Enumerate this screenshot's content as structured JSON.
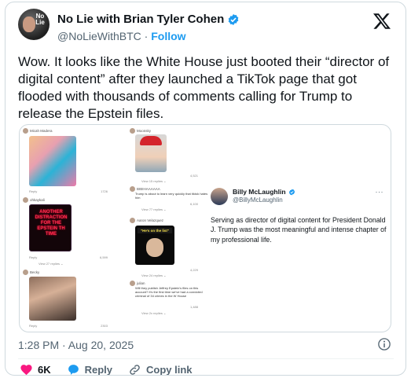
{
  "author": {
    "display_name": "No Lie with Brian Tyler Cohen",
    "handle": "@NoLieWithBTC",
    "separator": " · ",
    "follow_label": "Follow",
    "avatar_text": "No Lie"
  },
  "tweet": {
    "text": "Wow. It looks like the White House just booted their “director of digital content” after they launched a TikTok page that got flooded with thousands of comments calling for Trump to release the Epstein files."
  },
  "media": {
    "tiktok": {
      "col1": [
        {
          "user": "Micah Madera",
          "likes": "1726",
          "reply": "Reply",
          "replies": ""
        },
        {
          "user": "ohkaykali",
          "likes": "6,599",
          "reply": "Reply",
          "replies": "View 27 replies ⌄",
          "neon": "ANOTHER DISTRACTION FOR THE EPSTEIN TH TIME"
        },
        {
          "user": "Becky",
          "likes": "2303",
          "reply": "Reply",
          "replies": ""
        }
      ],
      "col2": [
        {
          "user": "Moonsky",
          "likes": "4,521",
          "replies": "View 15 replies ⌄"
        },
        {
          "user": "BIBIHAAAAAA",
          "comment": "Trump is about to learn very quickly that tiktok hates him",
          "likes": "6,100",
          "replies": "View 77 replies ⌄"
        },
        {
          "user": "Aaron Velazquez",
          "label": "\"He's on the list\"",
          "likes": "4,229",
          "replies": "View 24 replies ⌄"
        },
        {
          "user": "julian",
          "comment": "Will they publish Jeffrey Epstein's files on this account? It's the first time we've had a convicted criminal of 34 crimes in the W House",
          "likes": "1,488",
          "replies": "View 2x replies ⌄"
        }
      ]
    },
    "embedded_tweet": {
      "name": "Billy McLaughlin",
      "handle": "@BillyMcLaughlin",
      "more": "···",
      "text": "Serving as director of digital content for President Donald J. Trump was the most meaningful and intense chapter of my professional life."
    }
  },
  "timestamp": "1:28 PM · Aug 20, 2025",
  "actions": {
    "likes": "6K",
    "reply_label": "Reply",
    "copy_link_label": "Copy link"
  },
  "colors": {
    "accent": "#1d9bf0",
    "like": "#f91880",
    "muted": "#536471"
  }
}
